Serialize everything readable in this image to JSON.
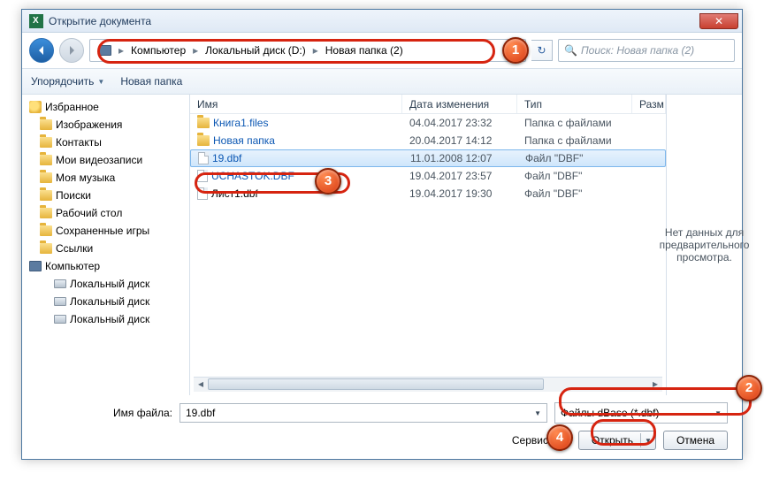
{
  "title": "Открытие документа",
  "breadcrumb": {
    "seg1": "Компьютер",
    "seg2": "Локальный диск (D:)",
    "seg3": "Новая папка (2)"
  },
  "search": {
    "placeholder": "Поиск: Новая папка (2)"
  },
  "toolbar": {
    "organize": "Упорядочить",
    "newfolder": "Новая папка"
  },
  "columns": {
    "name": "Имя",
    "date": "Дата изменения",
    "type": "Тип",
    "size": "Разм"
  },
  "sidebar": {
    "items": [
      "Избранное",
      "Изображения",
      "Контакты",
      "Мои видеозаписи",
      "Моя музыка",
      "Поиски",
      "Рабочий стол",
      "Сохраненные игры",
      "Ссылки"
    ],
    "computer": "Компьютер",
    "drives": [
      "Локальный диск",
      "Локальный диск",
      "Локальный диск"
    ]
  },
  "files": [
    {
      "name": "Книга1.files",
      "date": "04.04.2017 23:32",
      "type": "Папка с файлами",
      "kind": "folder"
    },
    {
      "name": "Новая папка",
      "date": "20.04.2017 14:12",
      "type": "Папка с файлами",
      "kind": "folder"
    },
    {
      "name": "19.dbf",
      "date": "11.01.2008 12:07",
      "type": "Файл \"DBF\"",
      "kind": "file",
      "sel": true
    },
    {
      "name": "UCHASTOK.DBF",
      "date": "19.04.2017 23:57",
      "type": "Файл \"DBF\"",
      "kind": "file"
    },
    {
      "name": "Лист1.dbf",
      "date": "19.04.2017 19:30",
      "type": "Файл \"DBF\"",
      "kind": "file"
    }
  ],
  "preview": "Нет данных для предварительного просмотра.",
  "footer": {
    "fname_label": "Имя файла:",
    "fname_value": "19.dbf",
    "ftype_value": "Файлы dBase (*.dbf)",
    "service": "Сервис",
    "open": "Открыть",
    "cancel": "Отмена"
  },
  "markers": {
    "m1": "1",
    "m2": "2",
    "m3": "3",
    "m4": "4"
  }
}
